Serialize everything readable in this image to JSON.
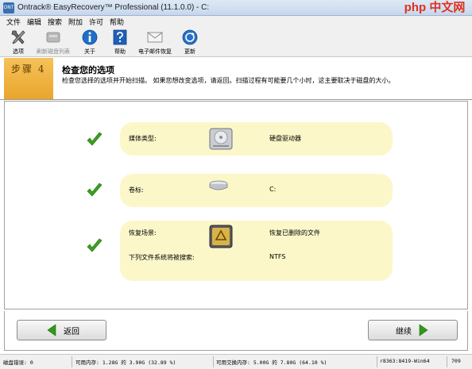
{
  "window": {
    "title": "Ontrack® EasyRecovery™ Professional (11.1.0.0) - C:",
    "app_icon_text": "ONT",
    "watermark": "php 中文网"
  },
  "menu": [
    "文件",
    "编辑",
    "搜索",
    "附加",
    "许可",
    "帮助"
  ],
  "toolbar": [
    {
      "label": "选项",
      "icon": "tools-icon",
      "enabled": true
    },
    {
      "label": "刷新磁盘列表",
      "icon": "refresh-disk-icon",
      "enabled": false
    },
    {
      "label": "关于",
      "icon": "info-icon",
      "enabled": true
    },
    {
      "label": "帮助",
      "icon": "help-icon",
      "enabled": true
    },
    {
      "label": "电子邮件恢复",
      "icon": "email-icon",
      "enabled": true
    },
    {
      "label": "更新",
      "icon": "update-icon",
      "enabled": true
    }
  ],
  "step": {
    "label": "步骤 4",
    "title": "检查您的选项",
    "description": "检查您选择的选项并开始扫描。 如果您想改变选项，请返回。扫描过程有可能要几个小时，这主要取决于磁盘的大小。"
  },
  "summary": {
    "media_label": "媒体类型:",
    "media_value": "硬盘驱动器",
    "volume_label": "卷标:",
    "volume_value": "C:",
    "scenario_label": "恢复场景:",
    "scenario_value": "恢复已删除的文件",
    "fs_label": "下列文件系统将被搜索:",
    "fs_value": "NTFS"
  },
  "nav": {
    "back_label": "返回",
    "continue_label": "继续"
  },
  "status": {
    "disk_errors": "磁盘错误: 0",
    "memory": "可用内存: 1.28G 的 3.90G (32.89 %)",
    "swap": "可用交换内存: 5.00G 的 7.80G (64.10 %)",
    "build": "r8363:8419-Win64",
    "code": "709"
  },
  "colors": {
    "accent": "#f3b23e",
    "panel": "#fbf7c9",
    "check": "#3aa31a",
    "arrow": "#2f9a1a"
  }
}
